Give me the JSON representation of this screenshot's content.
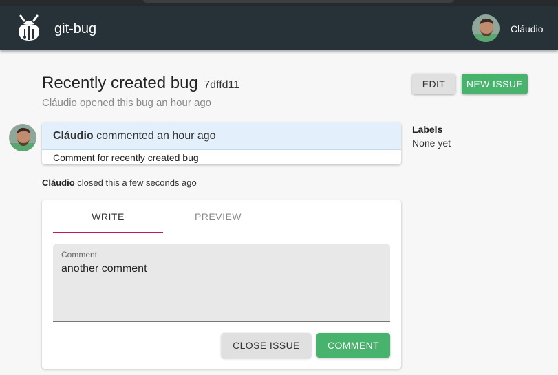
{
  "app": {
    "name": "git-bug",
    "user": "Cláudio"
  },
  "bug": {
    "title": "Recently created bug",
    "hash": "7dffd11",
    "subtitle": "Cláudio opened this bug an hour ago"
  },
  "toolbar": {
    "edit_label": "EDIT",
    "new_issue_label": "NEW ISSUE"
  },
  "timeline": {
    "comment": {
      "author": "Cláudio",
      "action": " commented an hour ago",
      "body": "Comment for recently created bug"
    },
    "event": {
      "author": "Cláudio",
      "action": " closed this a few seconds ago"
    }
  },
  "sidebar": {
    "labels_title": "Labels",
    "labels_value": "None yet"
  },
  "composer": {
    "tabs": [
      {
        "label": "WRITE",
        "active": true
      },
      {
        "label": "PREVIEW",
        "active": false
      }
    ],
    "field_label": "Comment",
    "field_value": "another comment",
    "close_label": "CLOSE ISSUE",
    "comment_label": "COMMENT"
  },
  "icons": {
    "logo": "bug-logo-icon",
    "avatar": "user-avatar"
  },
  "colors": {
    "appbar": "#263238",
    "accent_green": "#48b36c",
    "tab_indicator": "#c2185b",
    "comment_header": "#e3f0fc"
  }
}
